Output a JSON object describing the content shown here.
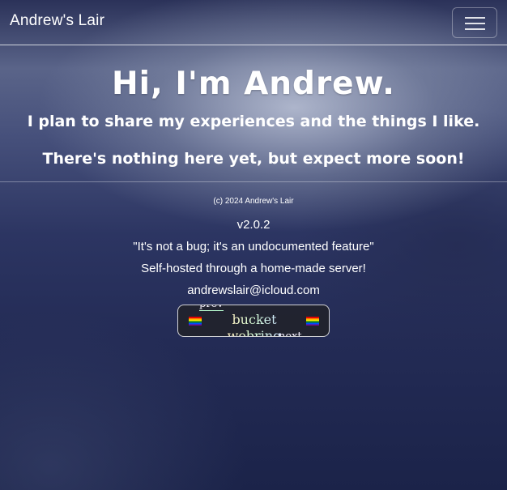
{
  "navbar": {
    "brand": "Andrew's Lair",
    "toggle_icon": "hamburger-menu-icon"
  },
  "hero": {
    "title": "Hi, I'm Andrew.",
    "subtitle": "I plan to share my experiences and the things I like.",
    "note": "There's nothing here yet, but expect more soon!"
  },
  "footer": {
    "copyright": "(c) 2024 Andrew's Lair",
    "version": "v2.0.2",
    "quote": "\"It's not a bug; it's an undocumented feature\"",
    "hosted": "Self-hosted through a home-made server!",
    "email": "andrewslair@icloud.com"
  },
  "webring": {
    "title": "bucket webring",
    "prev_label": "prev",
    "next_label": "next",
    "flag_icon": "rainbow-flag-icon"
  }
}
